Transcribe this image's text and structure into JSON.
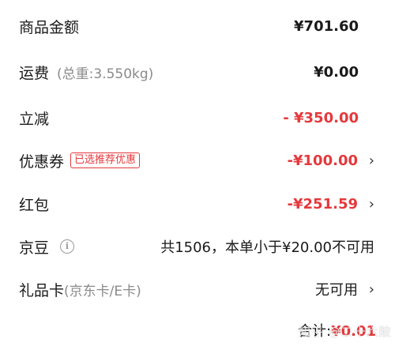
{
  "rows": [
    {
      "label": "商品金额",
      "value": "¥701.60"
    },
    {
      "label": "运费",
      "sub": "(总重:3.550kg)",
      "value": "¥0.00"
    },
    {
      "label": "立减",
      "value": "- ¥350.00"
    },
    {
      "label": "优惠券",
      "tag": "已选推荐优惠",
      "value": "-¥100.00",
      "arrow": "›"
    },
    {
      "label": "红包",
      "value": "-¥251.59",
      "arrow": "›"
    },
    {
      "label": "京豆",
      "info": "i",
      "value": "共1506，本单小于¥20.00不可用"
    },
    {
      "label": "礼品卡",
      "sub": "(京东卡/E卡)",
      "value": "无可用",
      "arrow": "›"
    }
  ],
  "total": {
    "label": "合计:",
    "amount": "¥0.01"
  },
  "watermark": "知乎 @二十六陂",
  "colors": {
    "accent": "#e4393c",
    "text": "#1a1a1a",
    "muted": "#8a8a8a"
  }
}
